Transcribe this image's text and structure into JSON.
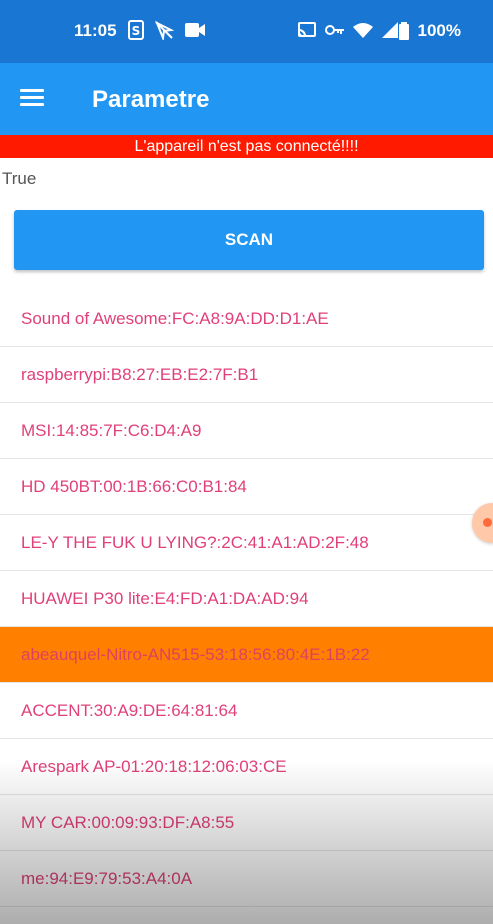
{
  "status_bar": {
    "time": "11:05",
    "battery_percent": "100%",
    "left_icons": [
      "s-icon",
      "location-off-icon",
      "video-icon"
    ],
    "right_icons": [
      "cast-icon",
      "vpn-key-icon",
      "wifi-icon",
      "signal-icon",
      "battery-icon"
    ]
  },
  "app_bar": {
    "title": "Parametre",
    "menu_icon": "hamburger-menu-icon",
    "color": "#2196f3"
  },
  "banner": {
    "text": "L'appareil n'est pas connecté!!!!",
    "color": "#ff1a00"
  },
  "status_value": "True",
  "scan_button": {
    "label": "SCAN"
  },
  "devices": [
    {
      "label": "Sound of Awesome:FC:A8:9A:DD:D1:AE"
    },
    {
      "label": "raspberrypi:B8:27:EB:E2:7F:B1"
    },
    {
      "label": "MSI:14:85:7F:C6:D4:A9"
    },
    {
      "label": "HD 450BT:00:1B:66:C0:B1:84"
    },
    {
      "label": "LE-Y THE FUK U LYING?:2C:41:A1:AD:2F:48"
    },
    {
      "label": "HUAWEI P30 lite:E4:FD:A1:DA:AD:94"
    },
    {
      "label": "abeauquel-Nitro-AN515-53:18:56:80:4E:1B:22",
      "selected": true
    },
    {
      "label": "ACCENT:30:A9:DE:64:81:64"
    },
    {
      "label": "Arespark AP-01:20:18:12:06:03:CE"
    },
    {
      "label": "MY CAR:00:09:93:DF:A8:55"
    },
    {
      "label": "me:94:E9:79:53:A4:0A"
    }
  ],
  "colors": {
    "device_text": "#e0407a",
    "selected_bg": "#ff8000"
  }
}
